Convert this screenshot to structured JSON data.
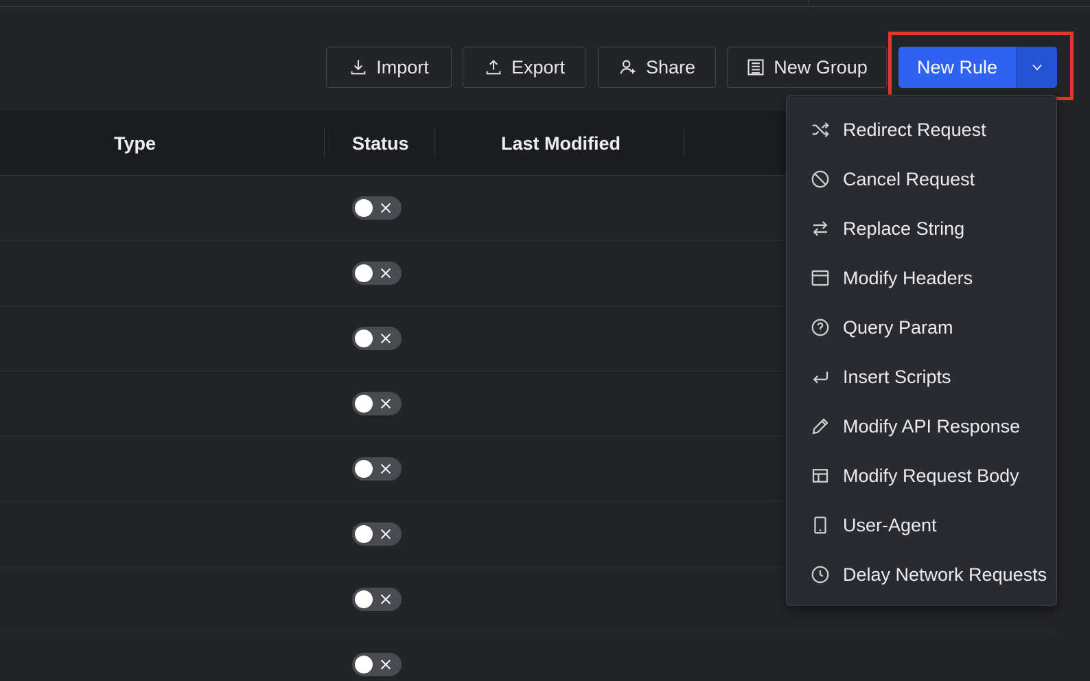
{
  "toolbar": {
    "import_label": "Import",
    "export_label": "Export",
    "share_label": "Share",
    "new_group_label": "New Group",
    "new_rule_label": "New Rule"
  },
  "table": {
    "columns": [
      "Type",
      "Status",
      "Last Modified"
    ],
    "rows": [
      {
        "status": "off"
      },
      {
        "status": "off"
      },
      {
        "status": "off"
      },
      {
        "status": "off"
      },
      {
        "status": "off"
      },
      {
        "status": "off"
      },
      {
        "status": "off"
      },
      {
        "status": "off"
      }
    ]
  },
  "new_rule_menu": {
    "items": [
      {
        "label": "Redirect Request",
        "icon": "shuffle-icon"
      },
      {
        "label": "Cancel Request",
        "icon": "ban-icon"
      },
      {
        "label": "Replace String",
        "icon": "swap-icon"
      },
      {
        "label": "Modify Headers",
        "icon": "window-icon"
      },
      {
        "label": "Query Param",
        "icon": "question-circle-icon"
      },
      {
        "label": "Insert Scripts",
        "icon": "enter-arrow-icon"
      },
      {
        "label": "Modify API Response",
        "icon": "pencil-icon"
      },
      {
        "label": "Modify Request Body",
        "icon": "layout-icon"
      },
      {
        "label": "User-Agent",
        "icon": "tablet-icon"
      },
      {
        "label": "Delay Network Requests",
        "icon": "clock-icon"
      }
    ]
  },
  "colors": {
    "background": "#232428",
    "primary": "#2f62f0",
    "highlight": "#e5372b"
  }
}
